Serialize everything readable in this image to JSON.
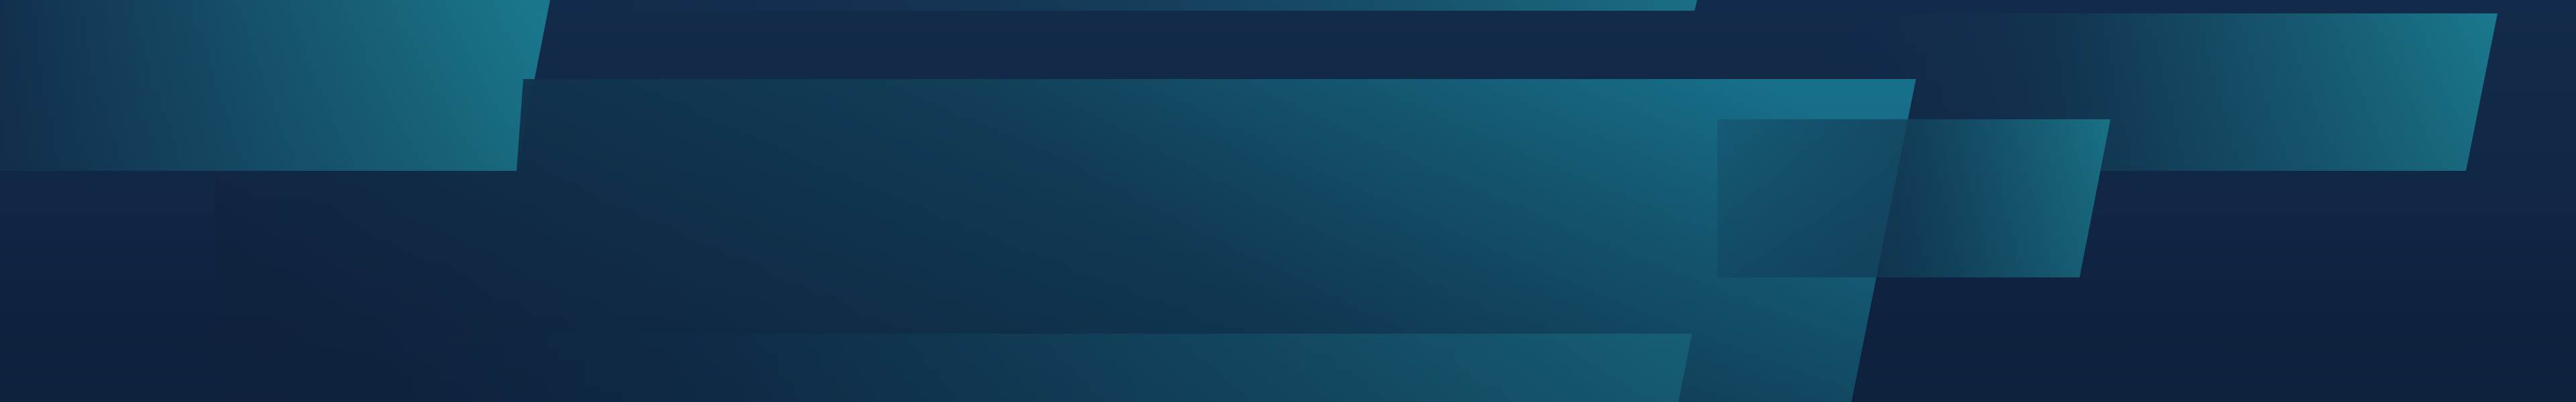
{
  "banner": {
    "kind": "decorative-abstract-background",
    "shape_style": "parallelogram-stripes",
    "colors": {
      "background_top": "#132b4a",
      "background_bottom": "#0e223f",
      "stripe_dark": "#12304d",
      "stripe_light": "#1a7a8e"
    }
  }
}
